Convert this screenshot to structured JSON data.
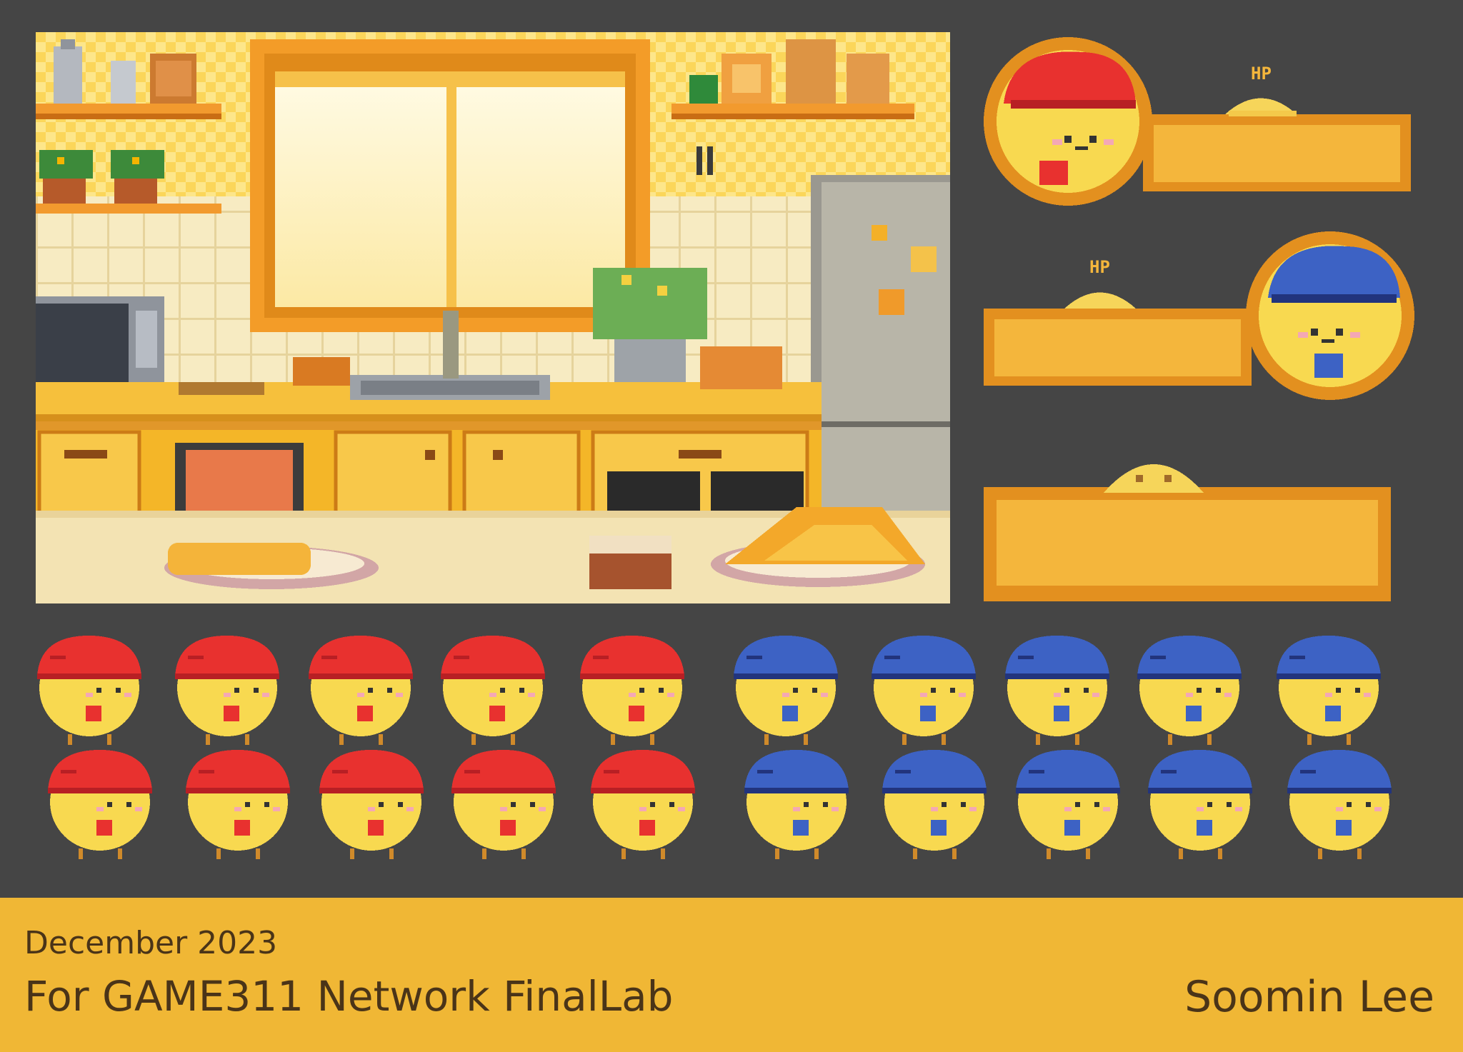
{
  "hp_label": "HP",
  "players": [
    {
      "id": "red",
      "color": "#e8312f",
      "dark": "#b81f24"
    },
    {
      "id": "blue",
      "color": "#3d62c4",
      "dark": "#22347d"
    }
  ],
  "footer": {
    "date": "December 2023",
    "title": "For GAME311 Network FinalLab",
    "author": "Soomin Lee"
  }
}
